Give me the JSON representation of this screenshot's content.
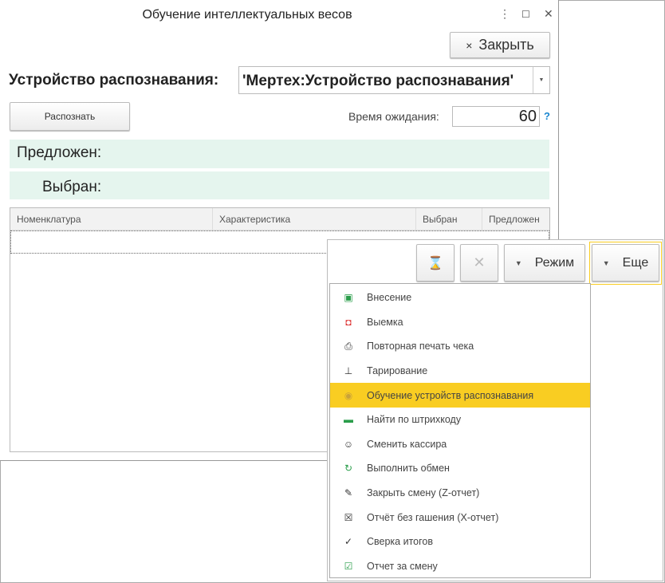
{
  "window": {
    "title": "Обучение интеллектуальных весов",
    "more_icon": "⋮",
    "maximize_icon": "☐",
    "close_icon": "✕"
  },
  "close_button": {
    "icon": "×",
    "label": "Закрыть"
  },
  "device": {
    "label": "Устройство распознавания:",
    "value": "'Мертех:Устройство распознавания'"
  },
  "recognize_button": "Распознать",
  "timeout": {
    "label": "Время ожидания:",
    "value": "60",
    "help": "?"
  },
  "suggested_label": "Предложен:",
  "selected_label": "Выбран:",
  "table": {
    "columns": [
      "Номенклатура",
      "Характеристика",
      "Выбран",
      "Предложен"
    ]
  },
  "toolbar": {
    "wait_icon": "⌛",
    "cancel_icon": "✕",
    "mode_label": "Режим",
    "more_label": "Еще",
    "arrow": "▼"
  },
  "menu": [
    {
      "icon": "▣",
      "label": "Внесение",
      "color": "#2a9d4a"
    },
    {
      "icon": "◘",
      "label": "Выемка",
      "color": "#d33"
    },
    {
      "icon": "⎙",
      "label": "Повторная печать чека",
      "color": "#333"
    },
    {
      "icon": "⊥",
      "label": "Тарирование",
      "color": "#333"
    },
    {
      "icon": "◉",
      "label": "Обучение устройств распознавания",
      "color": "#c9a23a",
      "highlighted": true
    },
    {
      "icon": "▬",
      "label": "Найти по штрихкоду",
      "color": "#2a9d4a"
    },
    {
      "icon": "☺",
      "label": "Сменить кассира",
      "color": "#333"
    },
    {
      "icon": "↻",
      "label": "Выполнить обмен",
      "color": "#2a9d4a"
    },
    {
      "icon": "✎",
      "label": "Закрыть смену (Z-отчет)",
      "color": "#333"
    },
    {
      "icon": "☒",
      "label": "Отчёт без гашения (X-отчет)",
      "color": "#333"
    },
    {
      "icon": "✓",
      "label": "Сверка итогов",
      "color": "#333"
    },
    {
      "icon": "☑",
      "label": "Отчет за смену",
      "color": "#2a9d4a"
    }
  ]
}
